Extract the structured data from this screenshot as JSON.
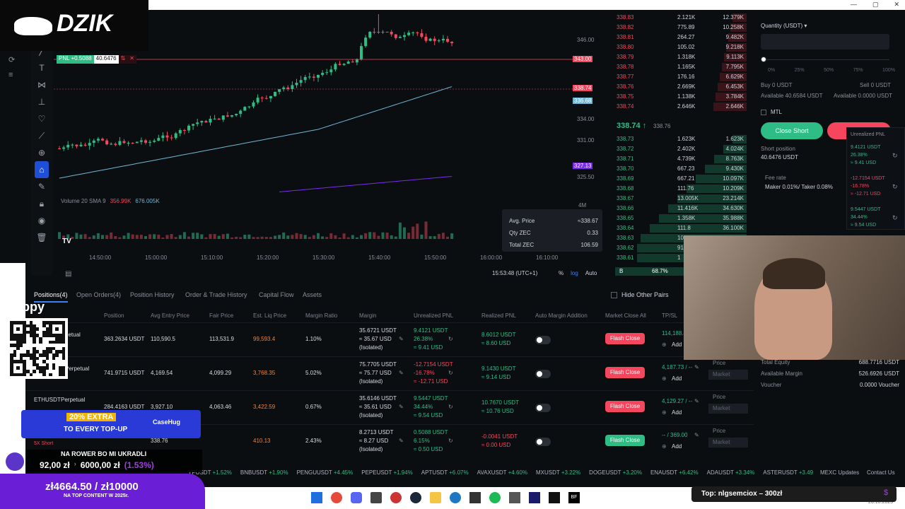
{
  "brand": "DZIK",
  "window_controls": [
    "—",
    "▢",
    "✕"
  ],
  "chart": {
    "pnl_label": "PNL +0.5088",
    "pnl_value": "40.6476",
    "price_axis": [
      "346.00",
      "343.00",
      "338.74",
      "336.68",
      "334.00",
      "331.00",
      "327.13",
      "325.50",
      "4M"
    ],
    "time_axis": [
      "14:50:00",
      "15:00:00",
      "15:10:00",
      "15:20:00",
      "15:30:00",
      "15:40:00",
      "15:50:00",
      "16:00:00",
      "16:10:00"
    ],
    "volume_label": "Volume 20 SMA 9",
    "volume_v1": "356.99K",
    "volume_v2": "676.005K",
    "clock": "15:53:48 (UTC+1)",
    "scale_opts": [
      "%",
      "log",
      "Auto"
    ],
    "tooltip": {
      "avg_label": "Avg. Price",
      "avg_value": "≈338.67",
      "qty_label": "Qty ZEC",
      "qty_value": "0.33",
      "total_label": "Total ZEC",
      "total_value": "106.59"
    }
  },
  "orderbook": {
    "asks": [
      [
        "338.83",
        "2.121K",
        "12.379K"
      ],
      [
        "338.82",
        "775.89",
        "10.258K"
      ],
      [
        "338.81",
        "264.27",
        "9.482K"
      ],
      [
        "338.80",
        "105.02",
        "9.218K"
      ],
      [
        "338.79",
        "1.318K",
        "9.113K"
      ],
      [
        "338.78",
        "1.165K",
        "7.795K"
      ],
      [
        "338.77",
        "176.16",
        "6.629K"
      ],
      [
        "338.76",
        "2.669K",
        "6.453K"
      ],
      [
        "338.75",
        "1.138K",
        "3.784K"
      ],
      [
        "338.74",
        "2.646K",
        "2.646K"
      ]
    ],
    "mid_price": "338.74 ↑",
    "mid_mark": "338.76",
    "bids": [
      [
        "338.73",
        "1.623K",
        "1.623K"
      ],
      [
        "338.72",
        "2.402K",
        "4.024K"
      ],
      [
        "338.71",
        "4.739K",
        "8.763K"
      ],
      [
        "338.70",
        "667.23",
        "9.430K"
      ],
      [
        "338.69",
        "667.21",
        "10.097K"
      ],
      [
        "338.68",
        "111.76",
        "10.209K"
      ],
      [
        "338.67",
        "13.005K",
        "23.214K"
      ],
      [
        "338.66",
        "11.416K",
        "34.630K"
      ],
      [
        "338.65",
        "1.358K",
        "35.988K"
      ],
      [
        "338.64",
        "111.8",
        "36.100K"
      ],
      [
        "338.63",
        "10",
        ""
      ],
      [
        "338.62",
        "91",
        ""
      ],
      [
        "338.61",
        "1",
        ""
      ]
    ],
    "buy_label": "B",
    "buy_pct": "68.7%"
  },
  "trade": {
    "qty_label": "Quantity (USDT) ▾",
    "slider_marks": [
      "0%",
      "25%",
      "50%",
      "75%",
      "100%"
    ],
    "buy_label": "Buy 0 USDT",
    "sell_label": "Sell 0 USDT",
    "avail_left": "Available 40.6584 USDT",
    "avail_right": "Available 0.0000 USDT",
    "mtl": "MTL",
    "close_short": "Close Short",
    "close_long": "C",
    "short_position_label": "Short position",
    "short_position_value": "40.6476 USDT",
    "fee_label": "Fee rate",
    "fee_value": "Maker 0.01%/ Taker 0.08%",
    "upnl_title": "Unrealized PNL",
    "upnl": [
      [
        "9.4121 USDT",
        "26.38%",
        "≈ 9.41 USD"
      ],
      [
        "-12.7154 USDT",
        "-16.78%",
        "≈ -12.71 USD"
      ],
      [
        "9.5447 USDT",
        "34.44%",
        "≈ 9.54 USD"
      ]
    ]
  },
  "account": {
    "rows": [
      [
        "Total Equity",
        "688.7716 USDT"
      ],
      [
        "Available Margin",
        "526.6926 USDT"
      ],
      [
        "Voucher",
        "0.0000 Voucher"
      ]
    ],
    "price_label": "Price",
    "market_label": "Market"
  },
  "positions": {
    "tabs": [
      "Positions(4)",
      "Open Orders(4)",
      "Position History",
      "Order & Trade History",
      "Capital Flow",
      "Assets"
    ],
    "hide_pairs": "Hide Other Pairs",
    "headers": [
      "Position",
      "Avg Entry Price",
      "Fair Price",
      "Est. Liq Price",
      "Margin Ratio",
      "Margin",
      "Unrealized PNL",
      "Realized PNL",
      "Auto Margin Addition",
      "Market Close All",
      "TP/SL"
    ],
    "rows": [
      {
        "sym": "",
        "tag": "petual",
        "pos": "363.2634 USDT",
        "entry": "110,590.5",
        "fair": "113,531.9",
        "liq": "99,593.4",
        "ratio": "1.10%",
        "m1": "35.6721 USDT",
        "m2": "≈ 35.67 USD",
        "m3": "(Isolated)",
        "u1": "9.4121 USDT",
        "u2": "26.38%",
        "u3": "≈ 9.41 USD",
        "r1": "8.6012 USDT",
        "r2": "≈ 8.60 USD",
        "tp": "114,188.4",
        "add": "Add"
      },
      {
        "sym": "",
        "tag": "Perpetual",
        "pos": "741.9715 USDT",
        "entry": "4,169.54",
        "fair": "4,099.29",
        "liq": "3,768.35",
        "ratio": "5.02%",
        "m1": "75.7705 USDT",
        "m2": "≈ 75.77 USD",
        "m3": "(Isolated)",
        "u1": "-12.7154 USDT",
        "u2": "-16.78%",
        "u3": "≈ -12.71 USD",
        "r1": "9.1430 USDT",
        "r2": "≈ 9.14 USD",
        "tp": "4,187.73 / --",
        "add": "Add"
      },
      {
        "sym": "ETHUSDT",
        "tag": "Perpetual",
        "pos": "284.4163 USDT",
        "entry": "3,927.10",
        "fair": "4,063.46",
        "liq": "3,422.59",
        "ratio": "0.67%",
        "m1": "35.6146 USDT",
        "m2": "≈ 35.61 USD",
        "m3": "(Isolated)",
        "u1": "9.5447 USDT",
        "u2": "34.44%",
        "u3": "≈ 9.54 USD",
        "r1": "10.7670 USDT",
        "r2": "≈ 10.76 USD",
        "tp": "4,129.27 / --",
        "add": "Add"
      },
      {
        "sym": "",
        "tag": "",
        "pos": "",
        "entry": "338.76",
        "fair": "",
        "liq": "410.13",
        "ratio": "2.43%",
        "m1": "8.2713 USDT",
        "m2": "≈ 8.27 USD",
        "m3": "(Isolated)",
        "u1": "0.5088 USDT",
        "u2": "6.15%",
        "u3": "≈ 0.50 USD",
        "r1": "-0.0041 USDT",
        "r2": "≈ 0.00 USD",
        "tp": "-- / 369.00",
        "add": "Add"
      }
    ],
    "flash_label": "Flash Close"
  },
  "ticker": {
    "items": [
      "YPUSDT +1.52%",
      "BNBUSDT +1.90%",
      "PENGUUSDT +4.45%",
      "PEPEUSDT +1.94%",
      "APTUSDT +6.07%",
      "AVAXUSDT +4.60%",
      "MXUSDT +3.22%",
      "DOGEUSDT +3.20%",
      "ENAUSDT +6.42%",
      "ADAUSDT +3.34%",
      "ASTERUSDT +3.49"
    ],
    "updates": "MEXC Updates",
    "contact": "Contact Us"
  },
  "overlays": {
    "tippy": "tippy",
    "promo_line1": "20% EXTRA",
    "promo_line2": "TO EVERY TOP-UP",
    "promo_brand": "CaseHug",
    "short_tag": "5X Short",
    "goal_title": "NA ROWER BO MI UKRADLI",
    "goal_current": "92,00 zł",
    "goal_target": "6000,00 zł",
    "goal_pct": "(1.53%)",
    "donate_amount": "zł4664.50 / zł10000",
    "donate_caption": "NA TOP CONTENT W 2025r.",
    "top_donor": "Top: nlgsemciox – 300zł"
  },
  "taskbar": {
    "date": "26.10.2025"
  },
  "colors": {
    "green": "#2ebd85",
    "red": "#f6465d",
    "bg": "#0b0e11",
    "accent_purple": "#7b2bf0"
  }
}
